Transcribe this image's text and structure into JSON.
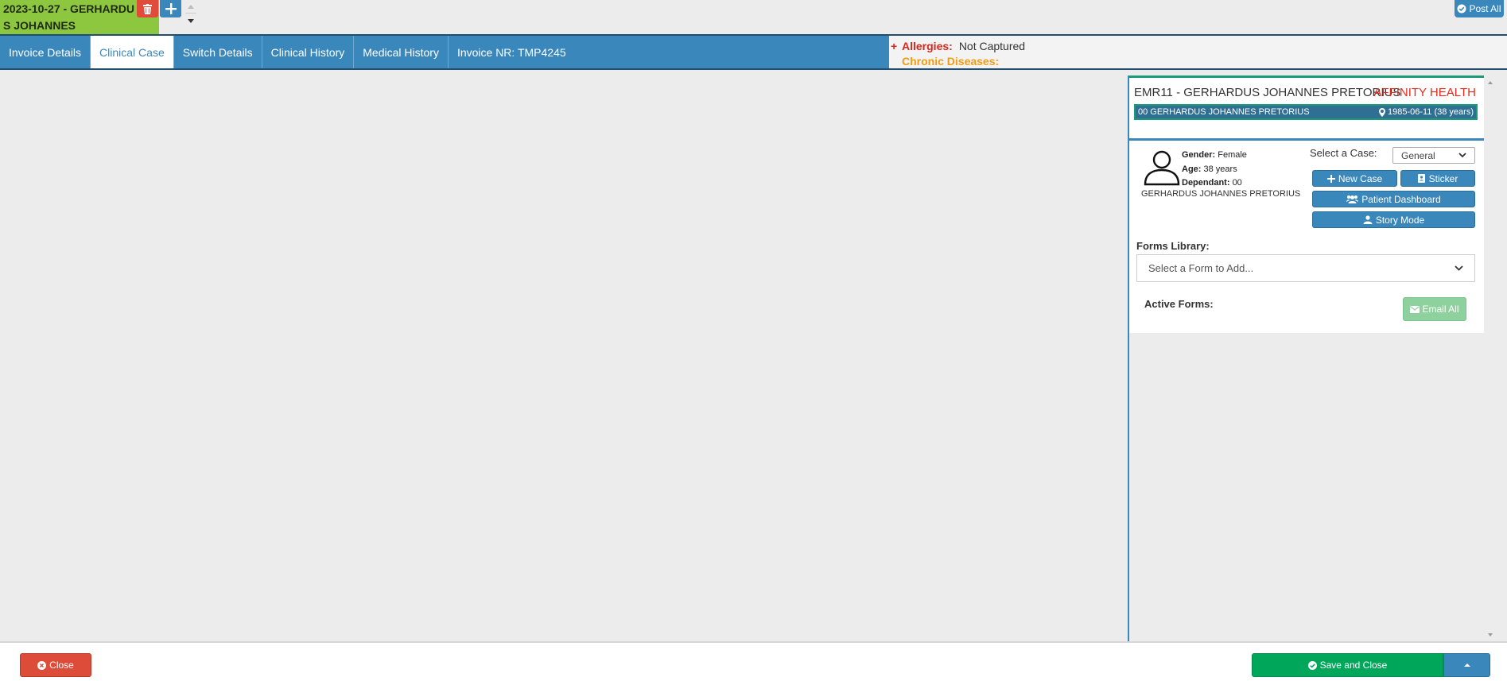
{
  "top": {
    "tab_line1": "2023-10-27 - GERHARDU",
    "tab_line2": "S JOHANNES",
    "post_all": "Post All"
  },
  "nav": {
    "tabs": [
      {
        "label": "Invoice Details",
        "active": false
      },
      {
        "label": "Clinical Case",
        "active": true
      },
      {
        "label": "Switch Details",
        "active": false
      },
      {
        "label": "Clinical History",
        "active": false
      },
      {
        "label": "Medical History",
        "active": false
      },
      {
        "label": "Invoice NR: TMP4245",
        "active": false
      }
    ]
  },
  "alerts": {
    "plus": "+",
    "allergies_label": "Allergies:",
    "allergies_value": "Not Captured",
    "chronic_label": "Chronic Diseases:"
  },
  "patient_header": {
    "name": "EMR11 - GERHARDUS JOHANNES PRETORIUS",
    "scheme": "AFFINITY HEALTH",
    "strip_name": "00 GERHARDUS JOHANNES PRETORIUS",
    "dob": "1985-06-11 (38 years)"
  },
  "case_panel": {
    "gender_label": "Gender:",
    "gender_value": "Female",
    "age_label": "Age:",
    "age_value": "38 years",
    "dependant_label": "Dependant:",
    "dependant_value": "00",
    "full_name": "GERHARDUS JOHANNES PRETORIUS",
    "select_case_label": "Select a Case:",
    "case_value": "General",
    "new_case": "New Case",
    "sticker": "Sticker",
    "patient_dashboard": "Patient Dashboard",
    "story_mode": "Story Mode",
    "forms_library_label": "Forms Library:",
    "forms_placeholder": "Select a Form to Add...",
    "active_forms_label": "Active Forms:",
    "email_all": "Email All"
  },
  "footer": {
    "close": "Close",
    "save_and_close": "Save and Close"
  },
  "colors": {
    "primary": "#3a87bb",
    "tab_green": "#8dc63f",
    "danger": "#dd4b39",
    "success": "#00a65a",
    "scheme_red": "#e32c1b",
    "chronic_orange": "#f39c12"
  }
}
